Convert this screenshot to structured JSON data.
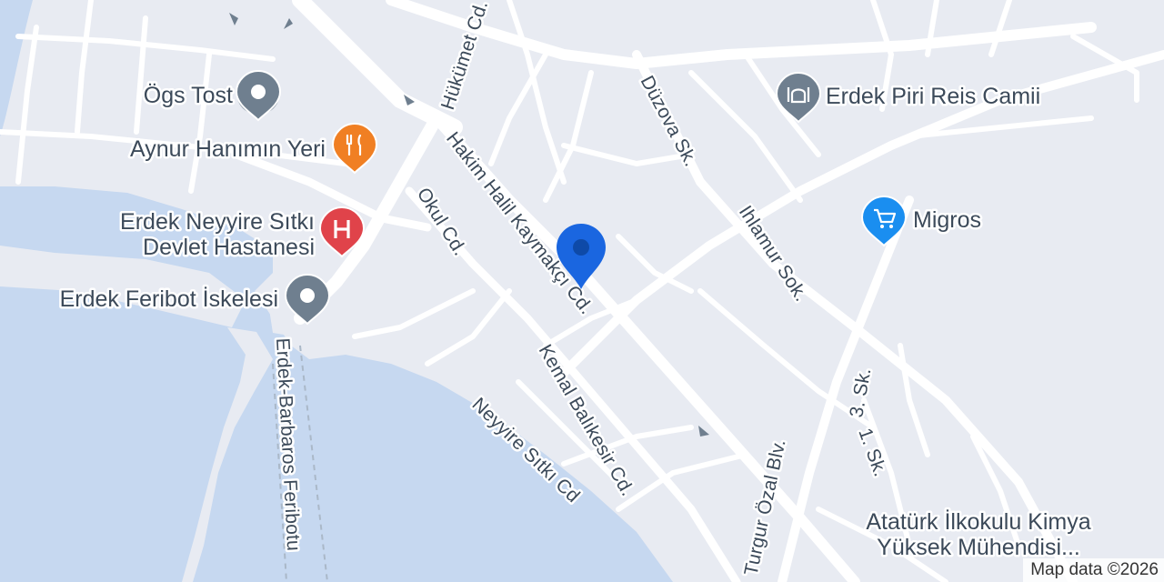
{
  "map": {
    "attribution": "Map data ©2026",
    "colors": {
      "land": "#e8ebf2",
      "water": "#c6d8f0",
      "road": "#ffffff",
      "label": "#3c4a5a",
      "pin": "#1a66e0",
      "restaurant_poi": "#f07f23",
      "hospital_poi": "#e0434a",
      "shopping_poi": "#1a8ef0",
      "generic_poi": "#6f7f8f"
    },
    "streets": {
      "hukumet": "Hükümet Cd.",
      "hakim": "Hakim Halil Kaymakçı Cd.",
      "okul": "Okul Cd.",
      "duzova": "Düzova Sk.",
      "ihlamur": "Ihlamur Sok.",
      "kemal": "Kemal Balıkesir Cd.",
      "neyyire": "Neyyire Sıtkı Cd",
      "turgut": "Turgur Özal Blv.",
      "uc_sk": "3. Sk.",
      "bir_sk": "1. Sk.",
      "feribot": "Erdek-Barbaros Feribotu"
    },
    "pois": {
      "ogs_tost": {
        "label": "Ögs Tost",
        "icon": "generic-pin-icon"
      },
      "aynur": {
        "label": "Aynur Hanımın Yeri",
        "icon": "restaurant-icon"
      },
      "hospital": {
        "label_line1": "Erdek Neyyire Sıtkı",
        "label_line2": "Devlet Hastanesi",
        "icon": "hospital-icon"
      },
      "feribot": {
        "label": "Erdek Feribot İskelesi",
        "icon": "generic-pin-icon"
      },
      "cami": {
        "label": "Erdek Piri Reis Camii",
        "icon": "mosque-icon"
      },
      "migros": {
        "label": "Migros",
        "icon": "shopping-cart-icon"
      },
      "ataturk": {
        "label_line1": "Atatürk İlkokulu Kimya",
        "label_line2": "Yüksek Mühendisi..."
      }
    },
    "marker": {
      "icon": "location-pin-icon"
    }
  }
}
